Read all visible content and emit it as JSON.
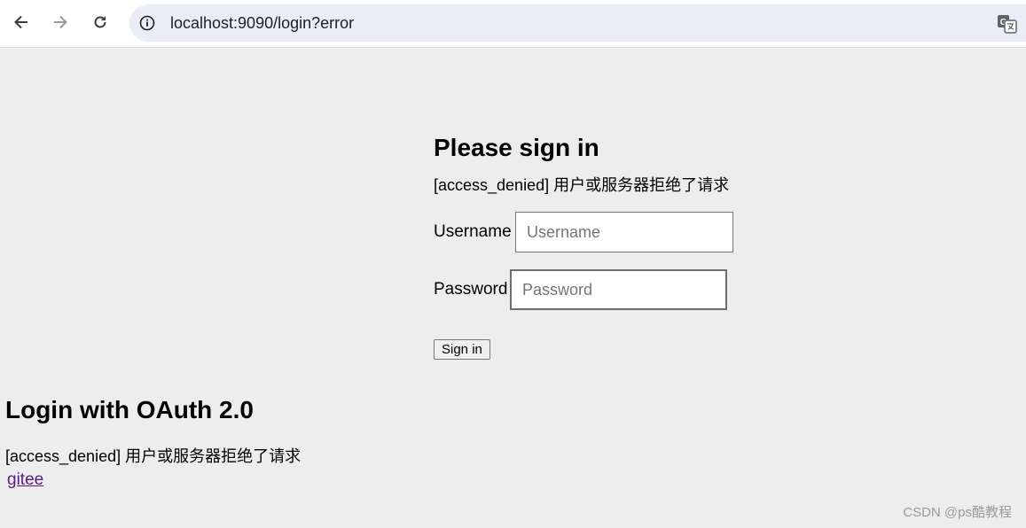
{
  "browser": {
    "url": "localhost:9090/login?error",
    "back_icon": "arrow-left-icon",
    "forward_icon": "arrow-right-icon",
    "reload_icon": "reload-icon",
    "info_icon": "info-icon",
    "translate_icon": "translate-icon"
  },
  "login": {
    "title": "Please sign in",
    "error": "[access_denied] 用户或服务器拒绝了请求",
    "username_label": "Username",
    "username_placeholder": "Username",
    "password_label": "Password",
    "password_placeholder": "Password",
    "submit_label": "Sign in"
  },
  "oauth": {
    "title": "Login with OAuth 2.0",
    "error": "[access_denied] 用户或服务器拒绝了请求",
    "providers": [
      {
        "label": "gitee"
      }
    ]
  },
  "watermark": "CSDN @ps酷教程",
  "colors": {
    "page_background": "#ededed",
    "omnibox_background": "#eaedf5",
    "visited_link": "#551a8b"
  }
}
